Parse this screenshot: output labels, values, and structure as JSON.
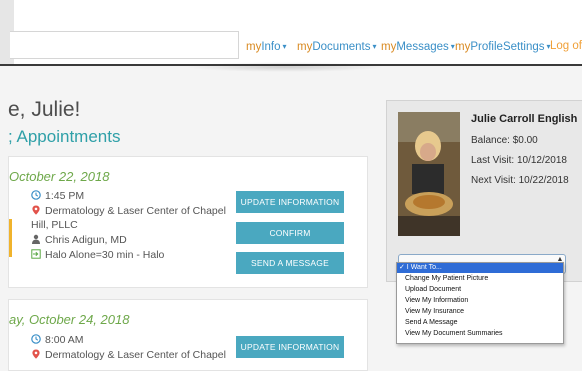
{
  "nav": {
    "prefix": "my",
    "items": [
      {
        "label": "Info"
      },
      {
        "label": "Documents"
      },
      {
        "label": "Messages"
      },
      {
        "label": "ProfileSettings"
      }
    ],
    "caret": "▾",
    "logout": "Log of"
  },
  "welcome": "e, Julie!",
  "appointments_heading": "; Appointments",
  "appointments": [
    {
      "date": "October 22, 2018",
      "time": "1:45 PM",
      "location_line1": "Dermatology & Laser Center of Chapel",
      "location_line2": "Hill, PLLC",
      "provider": "Chris Adigun, MD",
      "type": "Halo Alone=30 min - Halo",
      "buttons": {
        "update": "UPDATE INFORMATION",
        "confirm": "CONFIRM",
        "message": "SEND A MESSAGE"
      }
    },
    {
      "date": "ay, October 24, 2018",
      "time": "8:00 AM",
      "location_line1": "Dermatology & Laser Center of Chapel",
      "buttons": {
        "update": "UPDATE INFORMATION"
      }
    }
  ],
  "patient": {
    "name": "Julie Carroll English",
    "balance": "Balance: $0.00",
    "last_visit": "Last Visit: 10/12/2018",
    "next_visit": "Next Visit: 10/22/2018"
  },
  "dropdown": {
    "options": [
      "✓ I Want To...",
      "Change My Patient Picture",
      "Upload Document",
      "View My Information",
      "View My Insurance",
      "Send A Message",
      "View My Document Summaries"
    ],
    "arrow_up": "▲",
    "arrow_down": "▼"
  },
  "colors": {
    "nav_link": "#3a8fc7",
    "nav_my": "#d98a22",
    "heading_teal": "#2fa0a8",
    "date_green": "#6ea84a",
    "button": "#4aa8c0",
    "dropdown_selected": "#2f6cd6"
  }
}
